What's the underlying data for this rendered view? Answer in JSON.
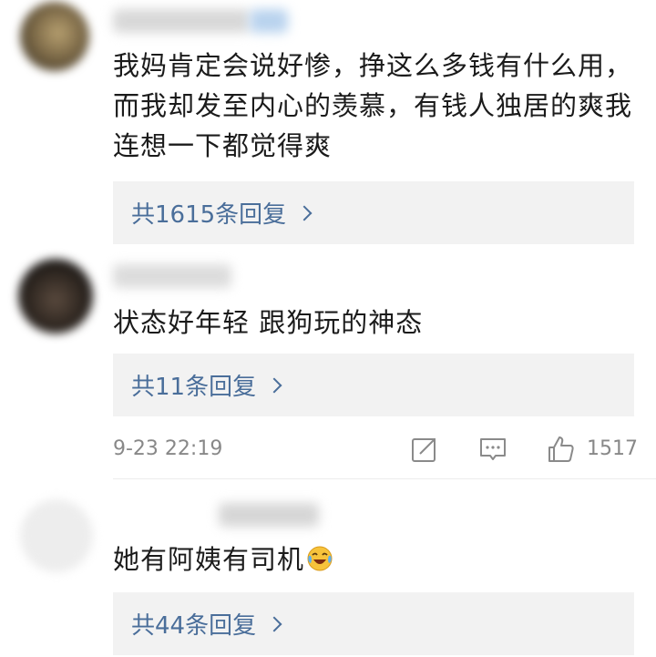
{
  "comments": [
    {
      "text": "我妈肯定会说好惨，挣这么多钱有什么用，而我却发至内心的羡慕，有钱人独居的爽我连想一下都觉得爽",
      "replies_label": "共1615条回复"
    },
    {
      "text": "状态好年轻 跟狗玩的神态",
      "replies_label": "共11条回复",
      "timestamp": "9-23 22:19",
      "like_count": "1517"
    },
    {
      "text": "她有阿姨有司机",
      "replies_label": "共44条回复"
    }
  ],
  "icons": {
    "share": "share-icon",
    "comment": "comment-icon",
    "like": "thumbs-up-icon",
    "emoji": "laughing-tears-emoji-icon",
    "chevron": "chevron-right-icon"
  },
  "colors": {
    "link": "#4a6e9a",
    "reply_bg": "#f2f2f2",
    "meta": "#888888"
  }
}
